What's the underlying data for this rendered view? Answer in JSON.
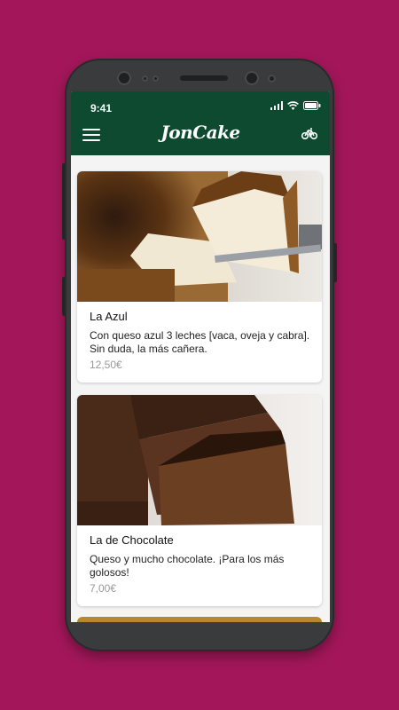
{
  "status_bar": {
    "time": "9:41"
  },
  "app_bar": {
    "logo": "JonCake"
  },
  "products": [
    {
      "name": "La Azul",
      "description": "Con queso azul 3 leches [vaca, oveja y cabra]. Sin duda, la más cañera.",
      "price": "12,50€"
    },
    {
      "name": "La de Chocolate",
      "description": "Queso y mucho chocolate. ¡Para los más golosos!",
      "price": "7,00€"
    }
  ],
  "colors": {
    "background": "#a3175a",
    "app_bar": "#0d4a2f",
    "price": "#999999"
  },
  "icons": [
    "menu-icon",
    "bicycle-icon",
    "signal-icon",
    "wifi-icon",
    "battery-icon"
  ]
}
